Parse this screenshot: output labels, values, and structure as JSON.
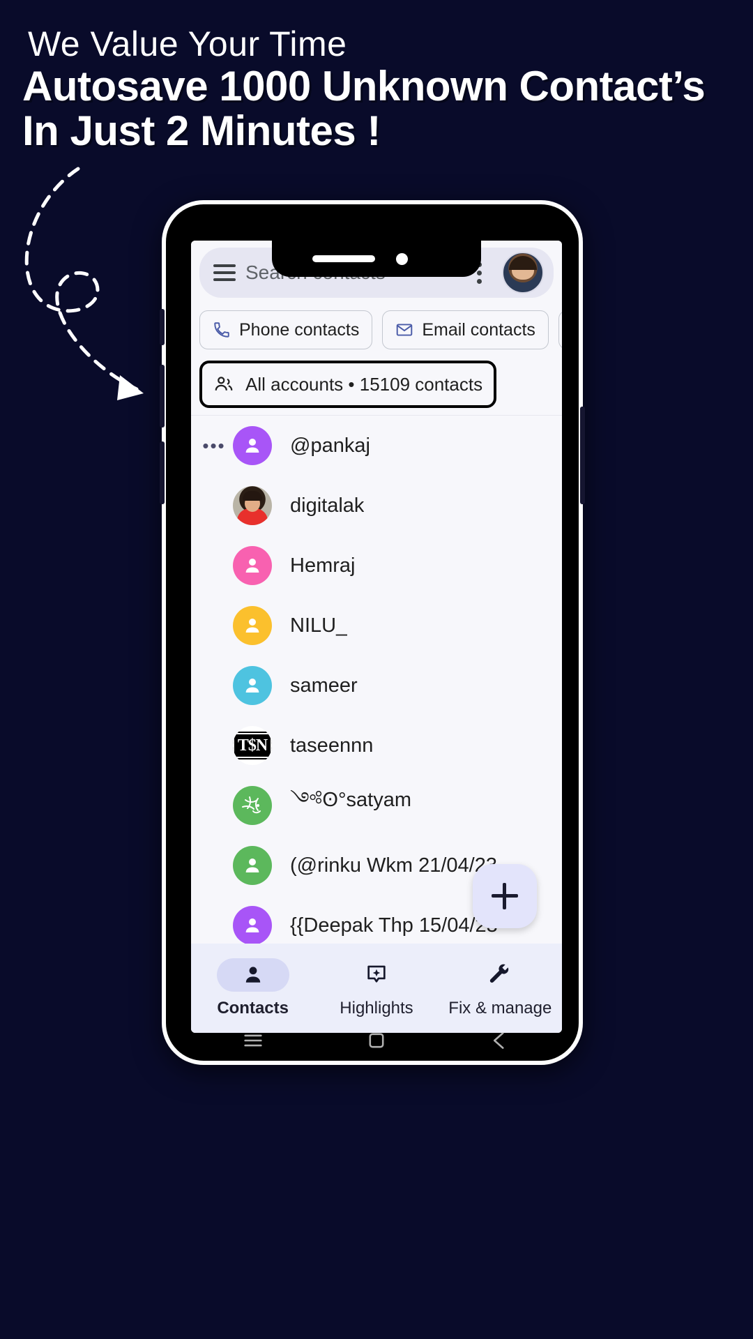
{
  "promo": {
    "eyebrow": "We Value Your Time",
    "headline_line1": "Autosave 1000 Unknown Contact’s",
    "headline_line2": "In Just 2 Minutes !",
    "background_color": "#090b2a",
    "text_color": "#ffffff"
  },
  "app": {
    "search": {
      "placeholder": "Search contacts",
      "menu_icon": "hamburger-icon",
      "overflow_icon": "kebab-menu-icon",
      "account_avatar": "profile-photo-avatar"
    },
    "filter_chips": [
      {
        "label": "Phone contacts",
        "icon": "phone-icon"
      },
      {
        "label": "Email contacts",
        "icon": "envelope-icon"
      },
      {
        "label": "",
        "icon": "building-icon"
      }
    ],
    "account_row": {
      "icon": "people-group-icon",
      "label": "All accounts • 15109 contacts",
      "highlighted": true,
      "highlight_color": "#000000"
    },
    "contacts": [
      {
        "name": "@pankaj",
        "avatar_type": "letter",
        "avatar_color": "#a855f7",
        "leading": "•••"
      },
      {
        "name": "digitalak",
        "avatar_type": "photo",
        "avatar_color": "#b9b4a6",
        "leading": ""
      },
      {
        "name": "Hemraj",
        "avatar_type": "letter",
        "avatar_color": "#f861b0",
        "leading": ""
      },
      {
        "name": "NILU_",
        "avatar_type": "letter",
        "avatar_color": "#fbc02d",
        "leading": ""
      },
      {
        "name": "sameer",
        "avatar_type": "letter",
        "avatar_color": "#4ec3e0",
        "leading": ""
      },
      {
        "name": "taseennn",
        "avatar_type": "logo-tsn",
        "avatar_color": "#ffffff",
        "leading": "",
        "badge_text": "T$N"
      },
      {
        "name": "༺ʘ°satyam",
        "avatar_type": "leaf",
        "avatar_color": "#5cb85c",
        "leading": ""
      },
      {
        "name": "(@rinku Wkm 21/04/23",
        "avatar_type": "letter",
        "avatar_color": "#5cb85c",
        "leading": ""
      },
      {
        "name": "{{Deepak Thp 15/04/23",
        "avatar_type": "letter",
        "avatar_color": "#a855f7",
        "leading": ""
      }
    ],
    "fab": {
      "icon": "plus-icon",
      "label": "Create contact",
      "color": "#e3e4fb"
    },
    "bottom_nav": [
      {
        "label": "Contacts",
        "icon": "person-icon",
        "active": true
      },
      {
        "label": "Highlights",
        "icon": "sparkle-badge-icon",
        "active": false
      },
      {
        "label": "Fix & manage",
        "icon": "wrench-icon",
        "active": false
      }
    ],
    "system_nav": [
      {
        "icon": "recents-icon"
      },
      {
        "icon": "home-icon"
      },
      {
        "icon": "back-icon"
      }
    ]
  }
}
